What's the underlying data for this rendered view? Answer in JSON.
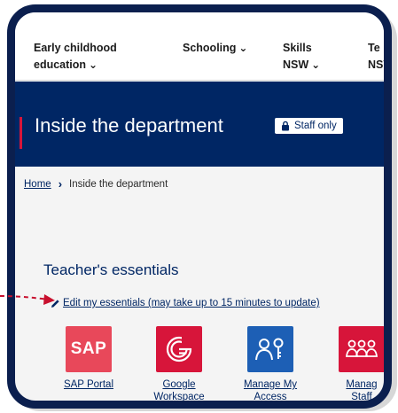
{
  "nav": {
    "items": [
      {
        "label_line1": "Early childhood",
        "label_line2": "education"
      },
      {
        "label_line1": "Schooling",
        "label_line2": ""
      },
      {
        "label_line1": "Skills",
        "label_line2": "NSW"
      },
      {
        "label_line1": "Te",
        "label_line2": "NSV"
      }
    ]
  },
  "banner": {
    "title": "Inside the department",
    "badge": "Staff only",
    "accent_color": "#d7153a",
    "background_color": "#002664"
  },
  "breadcrumb": {
    "home": "Home",
    "current": "Inside the department"
  },
  "essentials": {
    "title": "Teacher's essentials",
    "edit_link": "Edit my essentials (may take up to 15 minutes to update)",
    "tiles": [
      {
        "icon": "sap-icon",
        "icon_text": "SAP",
        "label_line1": "SAP Portal",
        "label_line2": "",
        "color": "#e8485a"
      },
      {
        "icon": "google-workspace-icon",
        "icon_text": "",
        "label_line1": "Google",
        "label_line2": "Workspace",
        "color": "#d7153a"
      },
      {
        "icon": "manage-access-icon",
        "icon_text": "",
        "label_line1": "Manage My",
        "label_line2": "Access",
        "color": "#1d5fb5"
      },
      {
        "icon": "manage-staff-icon",
        "icon_text": "",
        "label_line1": "Manag",
        "label_line2": "Staff",
        "color": "#d7153a"
      }
    ]
  },
  "theme": {
    "frame_color": "#0b1f4e",
    "link_color": "#002664"
  }
}
